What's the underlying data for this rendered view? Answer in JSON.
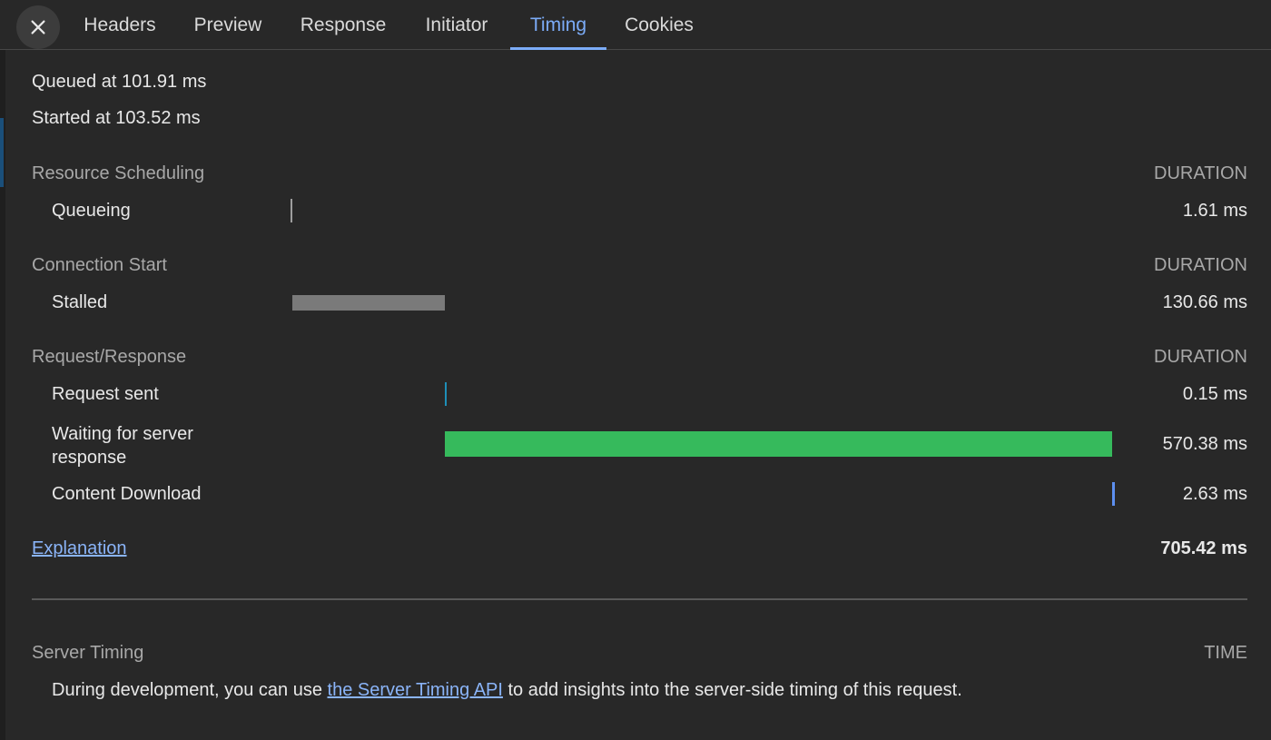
{
  "tabs": [
    {
      "label": "Headers"
    },
    {
      "label": "Preview"
    },
    {
      "label": "Response"
    },
    {
      "label": "Initiator"
    },
    {
      "label": "Timing"
    },
    {
      "label": "Cookies"
    }
  ],
  "active_tab": "Timing",
  "summary": {
    "queued_at": "Queued at 101.91 ms",
    "started_at": "Started at 103.52 ms"
  },
  "sections": {
    "resource_scheduling": {
      "title": "Resource Scheduling",
      "duration_header": "DURATION",
      "rows": [
        {
          "label": "Queueing",
          "value": "1.61 ms",
          "ms": 1.61,
          "start_ms": 0
        }
      ]
    },
    "connection_start": {
      "title": "Connection Start",
      "duration_header": "DURATION",
      "rows": [
        {
          "label": "Stalled",
          "value": "130.66 ms",
          "ms": 130.66,
          "start_ms": 1.61
        }
      ]
    },
    "request_response": {
      "title": "Request/Response",
      "duration_header": "DURATION",
      "rows": [
        {
          "label": "Request sent",
          "value": "0.15 ms",
          "ms": 0.15,
          "start_ms": 132.27
        },
        {
          "label": "Waiting for server response",
          "label_line1": "Waiting for server",
          "label_line2": "response",
          "value": "570.38 ms",
          "ms": 570.38,
          "start_ms": 132.42
        },
        {
          "label": "Content Download",
          "value": "2.63 ms",
          "ms": 2.63,
          "start_ms": 702.8
        }
      ]
    }
  },
  "explanation_link": "Explanation",
  "total": "705.42 ms",
  "server_timing": {
    "title": "Server Timing",
    "time_header": "TIME",
    "note_before": "During development, you can use ",
    "note_link": "the Server Timing API",
    "note_after": " to add insights into the server-side timing of this request."
  },
  "colors": {
    "queueing": "#9e9e9e",
    "stalled": "#7a7a7a",
    "request_sent": "#1e8fb8",
    "waiting": "#36ba5c",
    "content_download": "#5d8ff0",
    "accent": "#7cacf8"
  }
}
